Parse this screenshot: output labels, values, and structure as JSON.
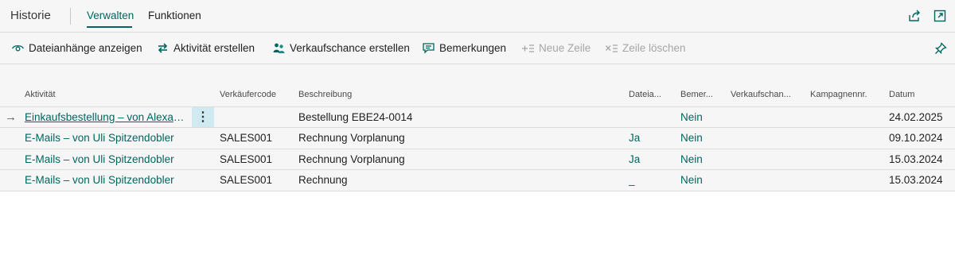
{
  "header": {
    "title": "Historie",
    "tabs": [
      {
        "label": "Verwalten",
        "active": true
      },
      {
        "label": "Funktionen",
        "active": false
      }
    ],
    "icons": [
      "share-icon",
      "expand-icon"
    ]
  },
  "actions": [
    {
      "label": "Dateianhänge anzeigen",
      "icon": "eye-icon",
      "enabled": true
    },
    {
      "label": "Aktivität erstellen",
      "icon": "arrows-cycle-icon",
      "enabled": true
    },
    {
      "label": "Verkaufschance erstellen",
      "icon": "people-icon",
      "enabled": true
    },
    {
      "label": "Bemerkungen",
      "icon": "comment-icon",
      "enabled": true
    },
    {
      "label": "Neue Zeile",
      "icon": "new-line-icon",
      "enabled": false
    },
    {
      "label": "Zeile löschen",
      "icon": "delete-line-icon",
      "enabled": false
    }
  ],
  "table": {
    "columns": [
      "Aktivität",
      "Verkäufercode",
      "Beschreibung",
      "Dateia...",
      "Bemer...",
      "Verkaufschan...",
      "Kampagnennr.",
      "Datum"
    ],
    "rows": [
      {
        "aktivitaet": "Einkaufsbestellung – von Alexand...",
        "verkaeufercode": "",
        "beschreibung": "Bestellung EBE24-0014",
        "dateianhaenge": "",
        "bemerkungen": "Nein",
        "verkaufschance": "",
        "kampagnennr": "",
        "datum": "24.02.2025",
        "selected": true
      },
      {
        "aktivitaet": "E-Mails – von Uli Spitzendobler",
        "verkaeufercode": "SALES001",
        "beschreibung": "Rechnung Vorplanung",
        "dateianhaenge": "Ja",
        "bemerkungen": "Nein",
        "verkaufschance": "",
        "kampagnennr": "",
        "datum": "09.10.2024",
        "selected": false
      },
      {
        "aktivitaet": "E-Mails – von Uli Spitzendobler",
        "verkaeufercode": "SALES001",
        "beschreibung": "Rechnung Vorplanung",
        "dateianhaenge": "Ja",
        "bemerkungen": "Nein",
        "verkaufschance": "",
        "kampagnennr": "",
        "datum": "15.03.2024",
        "selected": false
      },
      {
        "aktivitaet": "E-Mails – von Uli Spitzendobler",
        "verkaeufercode": "SALES001",
        "beschreibung": "Rechnung",
        "dateianhaenge": "_",
        "bemerkungen": "Nein",
        "verkaufschance": "",
        "kampagnennr": "",
        "datum": "15.03.2024",
        "selected": false
      }
    ]
  },
  "colors": {
    "accent": "#00665f",
    "selection": "#cfeaf0",
    "disabled": "#a6a6a6"
  }
}
